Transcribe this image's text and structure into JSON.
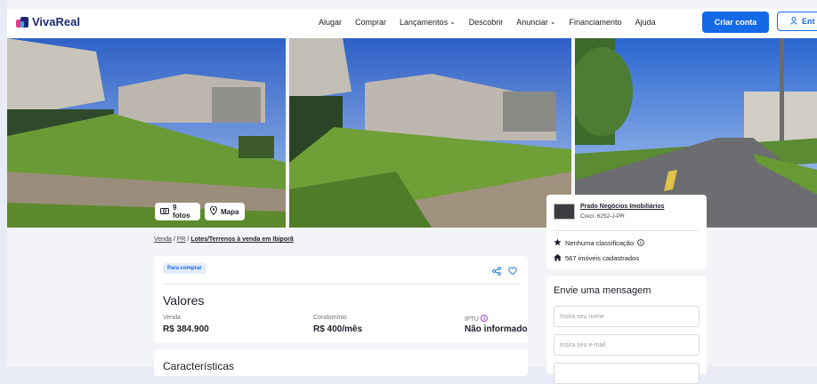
{
  "header": {
    "brand": "VivaReal",
    "nav": [
      "Alugar",
      "Comprar",
      "Lançamentos",
      "Descobrir",
      "Anunciar",
      "Financiamento",
      "Ajuda"
    ],
    "create_account": "Criar conta",
    "login": "Ent"
  },
  "gallery": {
    "photos_button": "9 fotos",
    "map_button": "Mapa"
  },
  "breadcrumb": {
    "item1": "Venda",
    "item2": "PR",
    "item3": "Lotes/Terrenos à venda em Ibiporã",
    "sep": "/"
  },
  "listing": {
    "badge": "Para comprar",
    "values_title": "Valores",
    "sale_label": "Venda",
    "sale_value": "R$ 384.900",
    "condo_label": "Condomínio",
    "condo_value": "R$ 400/mês",
    "iptu_label": "IPTU",
    "iptu_value": "Não informado",
    "features_title": "Características"
  },
  "agent": {
    "name": "Prado Negócios Imobiliários",
    "creci": "Creci: 6252-J-PR",
    "rating": "Nenhuma classificação",
    "listings": "567 imóveis cadastrados"
  },
  "message": {
    "title": "Envie uma mensagem",
    "name_placeholder": "Insira seu nome",
    "email_placeholder": "Insira seu e-mail"
  },
  "colors": {
    "brand_blue": "#1469e6",
    "logo_navy": "#1c2a74"
  }
}
